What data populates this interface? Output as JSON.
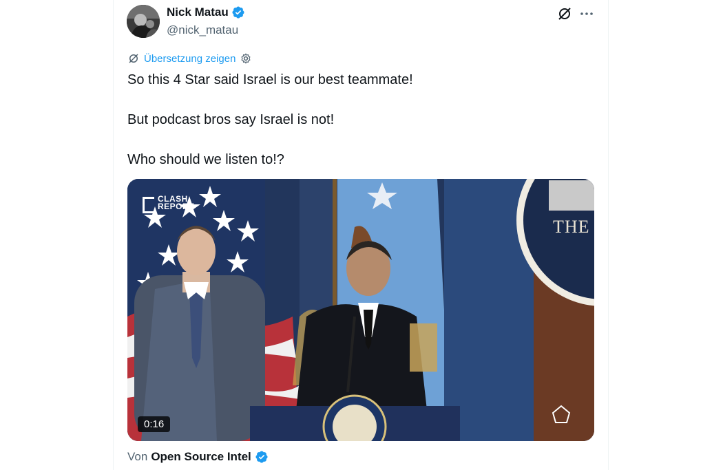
{
  "author": {
    "display_name": "Nick Matau",
    "handle": "@nick_matau",
    "verified": true
  },
  "actions": {
    "grok_icon": "grok-icon",
    "more_icon": "more-icon"
  },
  "translation": {
    "label": "Übersetzung zeigen",
    "icon": "translate-icon",
    "settings_icon": "gear-icon"
  },
  "tweet": {
    "lines": [
      "So this 4 Star said Israel is our best teammate!",
      "But podcast bros say Israel is not!",
      "Who should we listen to!?"
    ]
  },
  "media": {
    "watermark_line1": "CLASH",
    "watermark_line2": "REPORT",
    "background_text": "THE",
    "duration": "0:16"
  },
  "attribution": {
    "prefix": "Von",
    "source": "Open Source Intel",
    "verified": true
  },
  "colors": {
    "accent": "#1d9bf0",
    "text_primary": "#0f1419",
    "text_secondary": "#536471"
  }
}
